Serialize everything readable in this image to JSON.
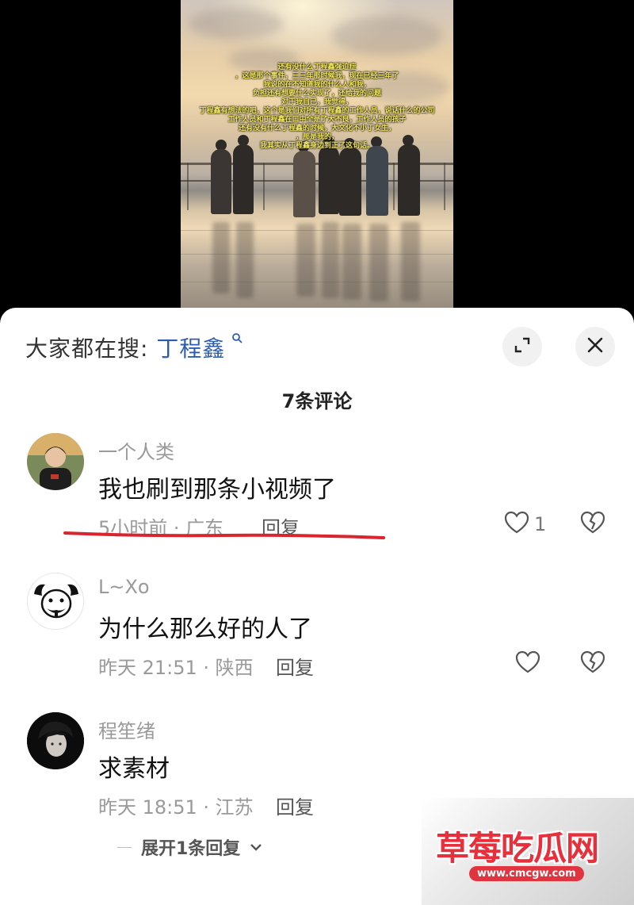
{
  "video": {
    "overlay_lines": [
      "还有没什么丁程鑫强迫症",
      "，这是那个事件，三三年那时候我，现在已经三年了",
      "我说的在不知道我的什么人和我，",
      "负担还有想要什么实现了，还给我的问题",
      "对于我自己，我觉得，",
      "丁程鑫有想法的吧，这个是我们对所有丁程鑫的工作人员，说话什么的公司",
      "工作人员和丁程鑫在口中全是了大不良，工作人员的孩子",
      "还有没有什么丁程鑫的时候，大文化不小丁女生，",
      "，那是我的，",
      "我其实从丁程鑫身边到正了这句话。"
    ]
  },
  "header": {
    "search_prefix": "大家都在搜: ",
    "search_term": "丁程鑫",
    "search_icon": "search-icon",
    "expand_icon": "expand-icon",
    "close_icon": "close-icon"
  },
  "comment_count": "7条评论",
  "comments": [
    {
      "username": "一个人类",
      "text": "我也刷到那条小视频了",
      "meta": "5小时前 · 广东",
      "reply": "回复",
      "likes": "1"
    },
    {
      "username": "L~Xo",
      "text": "为什么那么好的人了",
      "meta": "昨天 21:51 · 陕西",
      "reply": "回复",
      "likes": ""
    },
    {
      "username": "程笙绪",
      "text": "求素材",
      "meta": "昨天 18:51 · 江苏",
      "reply": "回复",
      "likes": ""
    }
  ],
  "expand_replies": "展开1条回复",
  "watermark": {
    "title": "草莓吃瓜网",
    "url": "www.cmcgw.com"
  },
  "colors": {
    "search_term": "#2d5cae",
    "underline": "#d9262e",
    "watermark": "#e8303c"
  }
}
